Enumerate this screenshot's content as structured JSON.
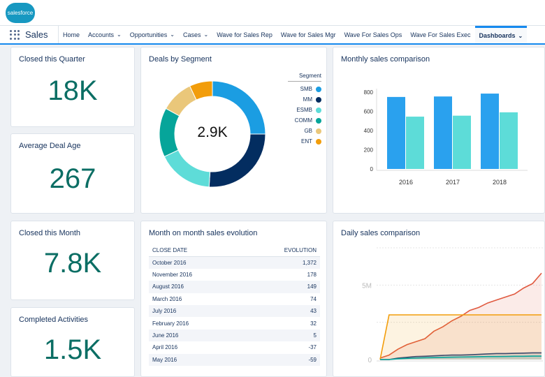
{
  "header": {
    "logo": "salesforce",
    "app_name": "Sales"
  },
  "nav": {
    "tabs": [
      {
        "label": "Home",
        "chevron": false
      },
      {
        "label": "Accounts",
        "chevron": true
      },
      {
        "label": "Opportunities",
        "chevron": true
      },
      {
        "label": "Cases",
        "chevron": true
      },
      {
        "label": "Wave for Sales Rep",
        "chevron": false
      },
      {
        "label": "Wave for Sales Mgr",
        "chevron": false
      },
      {
        "label": "Wave For Sales Ops",
        "chevron": false
      },
      {
        "label": "Wave For Sales Exec",
        "chevron": false
      },
      {
        "label": "Dashboards",
        "chevron": true,
        "active": true
      }
    ]
  },
  "kpis": [
    {
      "title": "Closed this Quarter",
      "value": "18K"
    },
    {
      "title": "Average Deal Age",
      "value": "267"
    },
    {
      "title": "Closed this Month",
      "value": "7.8K"
    },
    {
      "title": "Completed Activities",
      "value": "1.5K"
    }
  ],
  "donut": {
    "title": "Deals by Segment",
    "center": "2.9K",
    "legend_title": "Segment",
    "chart_data": {
      "type": "pie",
      "total": "2.9K",
      "slices": [
        {
          "name": "SMB",
          "share": 0.25,
          "color": "#1b9de2"
        },
        {
          "name": "MM",
          "share": 0.26,
          "color": "#032d60"
        },
        {
          "name": "ESMB",
          "share": 0.17,
          "color": "#5edcd8"
        },
        {
          "name": "COMM",
          "share": 0.15,
          "color": "#06a59a"
        },
        {
          "name": "GB",
          "share": 0.1,
          "color": "#eac77a"
        },
        {
          "name": "ENT",
          "share": 0.07,
          "color": "#f29d0b"
        }
      ]
    }
  },
  "monthly": {
    "title": "Monthly sales comparison",
    "chart_data": {
      "type": "bar",
      "categories": [
        "2016",
        "2017",
        "2018"
      ],
      "series": [
        {
          "values": [
            750,
            755,
            785
          ],
          "color": "#2aa1ee"
        },
        {
          "values": [
            545,
            555,
            590
          ],
          "color": "#5ddcd8"
        }
      ],
      "ylim": [
        0,
        800
      ],
      "yticks": [
        "0",
        "200",
        "400",
        "600",
        "800"
      ]
    }
  },
  "table": {
    "title": "Month on month sales evolution",
    "headers": [
      "CLOSE DATE",
      "EVOLUTION"
    ],
    "rows": [
      [
        "October 2016",
        "1,372"
      ],
      [
        "November 2016",
        "178"
      ],
      [
        "August 2016",
        "149"
      ],
      [
        "March 2016",
        "74"
      ],
      [
        "July 2016",
        "43"
      ],
      [
        "February 2016",
        "32"
      ],
      [
        "June 2016",
        "5"
      ],
      [
        "April 2016",
        "-37"
      ],
      [
        "May 2016",
        "-59"
      ]
    ]
  },
  "daily": {
    "title": "Daily sales comparison",
    "chart_data": {
      "type": "area",
      "yticks": [
        "0",
        "5M"
      ],
      "ylim": [
        0,
        7.5
      ],
      "series": [
        {
          "color": "#e0593f",
          "values": [
            0.1,
            0.3,
            0.7,
            1.0,
            1.2,
            1.4,
            1.9,
            2.2,
            2.6,
            2.9,
            3.3,
            3.5,
            3.8,
            4.0,
            4.2,
            4.4,
            4.8,
            5.1,
            5.8
          ]
        },
        {
          "color": "#f29d0b",
          "values": [
            0,
            3,
            3,
            3,
            3,
            3,
            3,
            3,
            3,
            3,
            3,
            3,
            3,
            3,
            3,
            3,
            3,
            3,
            3
          ]
        },
        {
          "color": "#3b4a6b",
          "values": [
            0,
            0,
            0.1,
            0.15,
            0.2,
            0.22,
            0.25,
            0.28,
            0.3,
            0.3,
            0.32,
            0.35,
            0.38,
            0.4,
            0.4,
            0.42,
            0.43,
            0.45,
            0.45
          ]
        },
        {
          "color": "#06a59a",
          "values": [
            0,
            0,
            0.05,
            0.08,
            0.1,
            0.12,
            0.13,
            0.15,
            0.16,
            0.17,
            0.18,
            0.19,
            0.2,
            0.2,
            0.21,
            0.22,
            0.22,
            0.23,
            0.23
          ]
        }
      ]
    }
  }
}
